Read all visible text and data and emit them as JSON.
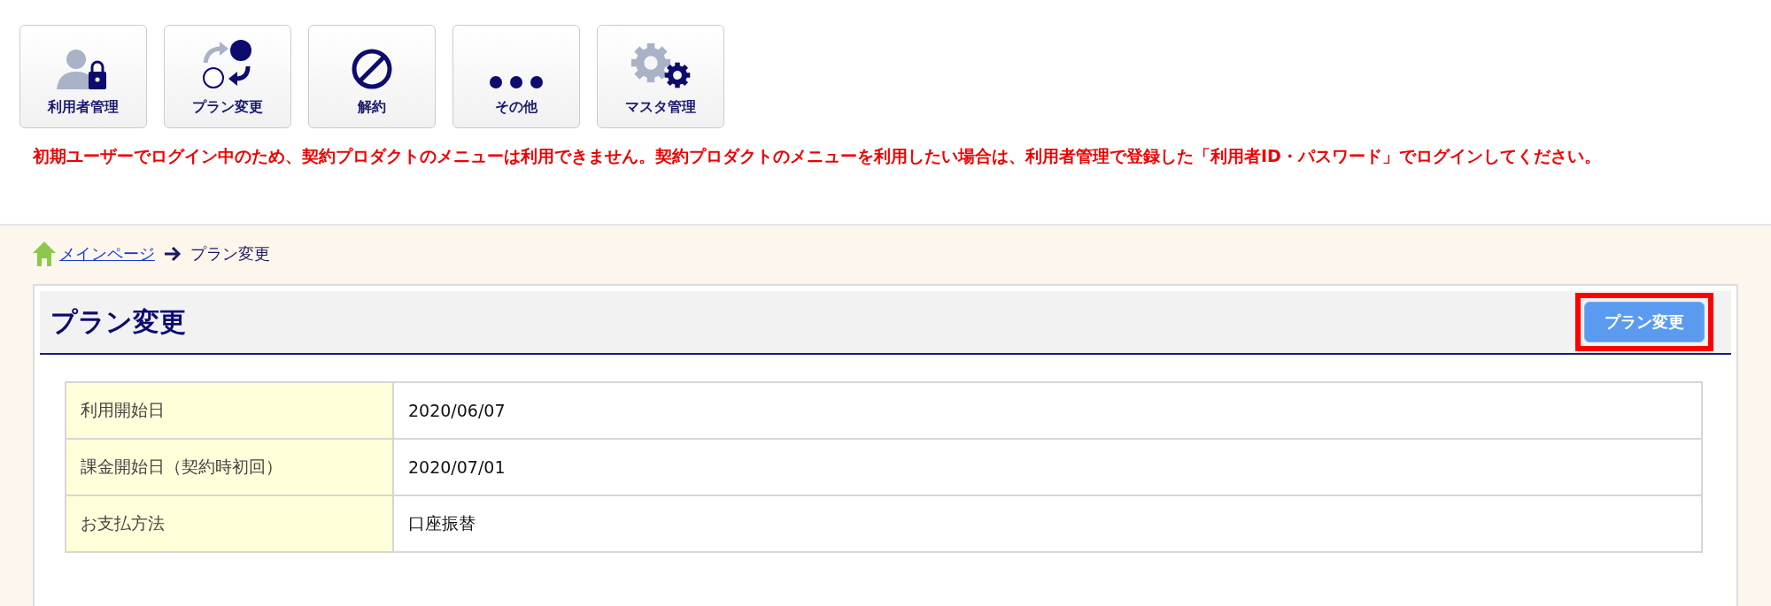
{
  "menu": [
    {
      "kind": "users",
      "label": "利用者管理"
    },
    {
      "kind": "plan",
      "label": "プラン変更"
    },
    {
      "kind": "cancel",
      "label": "解約"
    },
    {
      "kind": "other",
      "label": "その他"
    },
    {
      "kind": "master",
      "label": "マスタ管理"
    }
  ],
  "warning": "初期ユーザーでログイン中のため、契約プロダクトのメニューは利用できません。契約プロダクトのメニューを利用したい場合は、利用者管理で登録した「利用者ID・パスワード」でログインしてください。",
  "breadcrumb": {
    "link": "メインページ",
    "current": "プラン変更"
  },
  "panel": {
    "title": "プラン変更",
    "button": {
      "label": "プラン変更",
      "highlighted": true
    }
  },
  "table": {
    "rows": [
      {
        "label": "利用開始日",
        "value": "2020/06/07"
      },
      {
        "label": "課金開始日（契約時初回）",
        "value": "2020/07/01"
      },
      {
        "label": "お支払方法",
        "value": "口座振替"
      }
    ]
  }
}
